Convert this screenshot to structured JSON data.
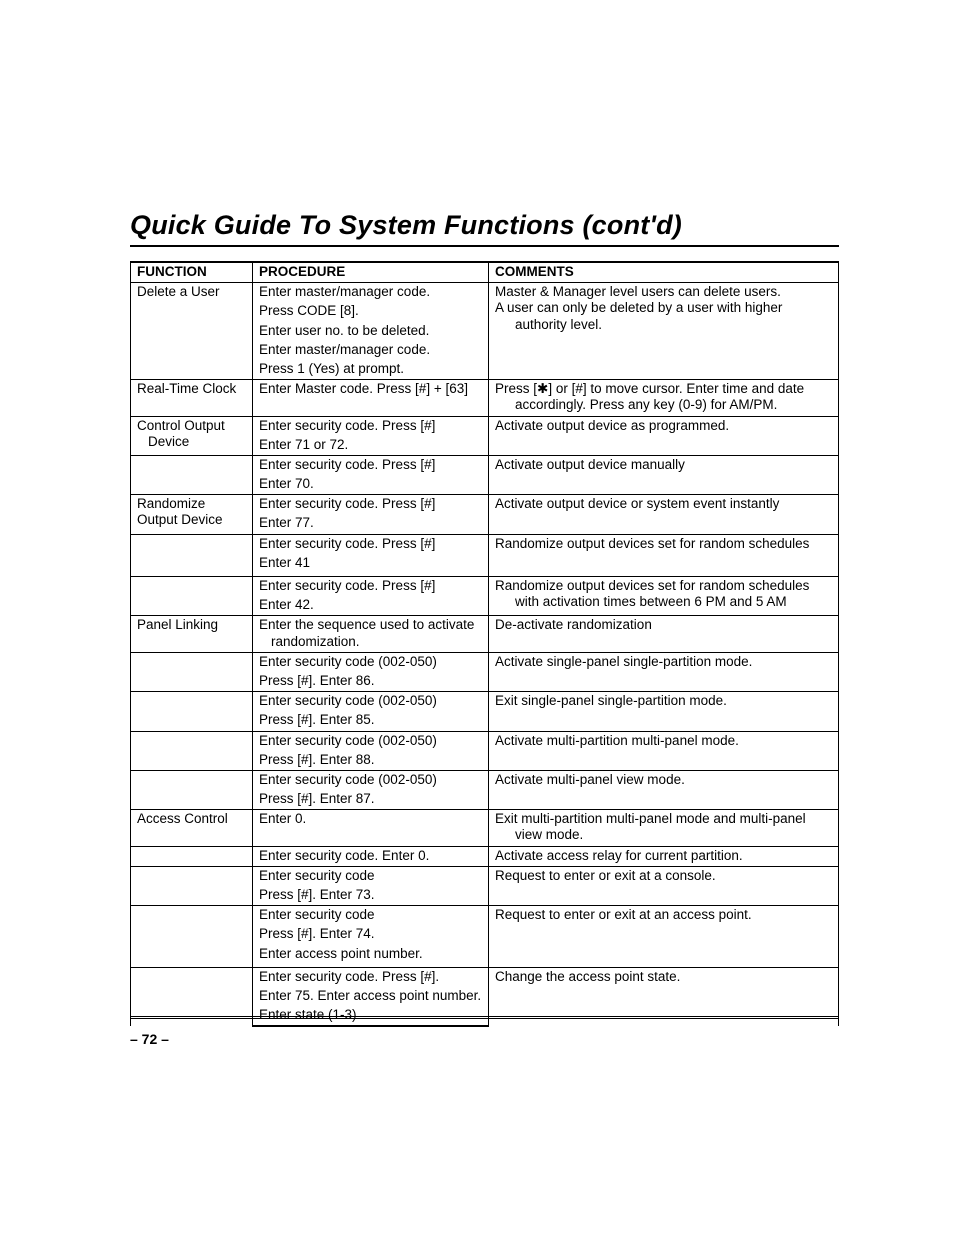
{
  "title": "Quick Guide To System Functions (cont'd)",
  "page_number": "– 72 –",
  "headers": {
    "function": "FUNCTION",
    "procedure": "PROCEDURE",
    "comments": "COMMENTS"
  },
  "rows": [
    {
      "function": [
        "Delete a User"
      ],
      "procedure": [
        "Enter master/manager code.",
        "Press CODE [8].",
        "Enter user no. to be deleted.",
        "Enter master/manager code.",
        "Press 1 (Yes) at prompt."
      ],
      "comments": [
        "Master & Manager level users can delete users.",
        "A user can only be deleted by a user with higher authority level."
      ]
    },
    {
      "function": [
        "Real-Time Clock"
      ],
      "procedure": [
        "Enter Master code.  Press [#] + [63]"
      ],
      "comments": [
        "Press [✱] or [#] to move cursor. Enter time and date accordingly. Press any key (0-9) for AM/PM."
      ]
    },
    {
      "function": [
        "Control Output",
        "Device"
      ],
      "procedure": [
        "Enter security code.  Press [#]",
        "Enter 71 or 72."
      ],
      "comments": [
        "Activate output device as programmed."
      ]
    },
    {
      "function": [],
      "procedure": [
        "Enter security code.  Press [#]",
        "Enter 70."
      ],
      "comments": [
        "Activate output device manually"
      ]
    },
    {
      "function": [
        "Randomize",
        "Output Device"
      ],
      "procedure": [
        "Enter security code.  Press [#]",
        "Enter 77."
      ],
      "comments": [
        "Activate output device or system event instantly"
      ]
    },
    {
      "function": [],
      "procedure": [
        "Enter security code.  Press [#]",
        "Enter 41",
        ""
      ],
      "comments": [
        "Randomize output devices set for random schedules"
      ]
    },
    {
      "function": [],
      "procedure": [
        "Enter security code.  Press [#]",
        "Enter 42."
      ],
      "comments": [
        "Randomize output devices set for random schedules with activation times between 6 PM and 5 AM"
      ]
    },
    {
      "function": [
        "Panel Linking"
      ],
      "procedure": [
        "Enter the sequence used to activate randomization."
      ],
      "comments": [
        "De-activate randomization"
      ]
    },
    {
      "function": [],
      "procedure": [
        "Enter security code (002-050)",
        "Press [#].  Enter 86."
      ],
      "comments": [
        "Activate single-panel single-partition mode."
      ]
    },
    {
      "function": [],
      "procedure": [
        "Enter security code (002-050)",
        "Press [#].  Enter 85."
      ],
      "comments": [
        "Exit single-panel single-partition mode."
      ]
    },
    {
      "function": [],
      "procedure": [
        "Enter security code (002-050)",
        "Press [#].  Enter 88."
      ],
      "comments": [
        "Activate multi-partition multi-panel mode."
      ]
    },
    {
      "function": [],
      "procedure": [
        "Enter security code (002-050)",
        "Press [#].  Enter 87."
      ],
      "comments": [
        "Activate multi-panel view mode."
      ]
    },
    {
      "function": [
        "Access Control"
      ],
      "procedure": [
        "Enter 0."
      ],
      "comments": [
        "Exit multi-partition multi-panel mode and multi-panel view mode."
      ]
    },
    {
      "function": [],
      "procedure": [
        "Enter security code.  Enter 0."
      ],
      "comments": [
        "Activate access relay for current partition."
      ]
    },
    {
      "function": [],
      "procedure": [
        "Enter security code",
        "Press [#].  Enter 73."
      ],
      "comments": [
        "Request to enter or exit at a console."
      ]
    },
    {
      "function": [],
      "procedure": [
        "Enter security code",
        "Press [#].  Enter 74.",
        "Enter access point number.",
        ""
      ],
      "comments": [
        "Request to enter or exit at an access point."
      ]
    },
    {
      "function": [],
      "procedure": [
        "Enter security code.  Press [#].",
        "Enter 75. Enter access point number.",
        "Enter state (1-3)"
      ],
      "comments": [
        "Change the access point state."
      ]
    }
  ]
}
